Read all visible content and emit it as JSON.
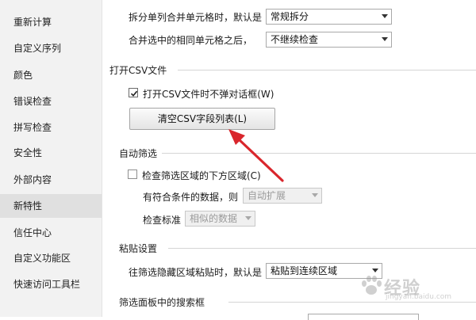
{
  "sidebar": {
    "items": [
      {
        "label": "重新计算"
      },
      {
        "label": "自定义序列"
      },
      {
        "label": "颜色"
      },
      {
        "label": "错误检查"
      },
      {
        "label": "拼写检查"
      },
      {
        "label": "安全性"
      },
      {
        "label": "外部内容"
      },
      {
        "label": "新特性",
        "active": true
      },
      {
        "label": "信任中心"
      },
      {
        "label": "自定义功能区"
      },
      {
        "label": "快速访问工具栏"
      }
    ]
  },
  "merge": {
    "split_label": "拆分单列合并单元格时，默认是",
    "split_value": "常规拆分",
    "after_merge_label": "合并选中的相同单元格之后，",
    "after_merge_value": "不继续检查"
  },
  "csv": {
    "section_title": "打开CSV文件",
    "checkbox_label": "打开CSV文件时不弹对话框(W)",
    "checkbox_checked": true,
    "clear_button": "清空CSV字段列表(L)"
  },
  "autofilter": {
    "section_title": "自动筛选",
    "checkbox_label": "检查筛选区域的下方区域(C)",
    "checkbox_checked": false,
    "condition_label": "有符合条件的数据，则",
    "condition_value": "自动扩展",
    "criteria_label": "检查标准",
    "criteria_value": "相似的数据"
  },
  "paste": {
    "section_title": "粘贴设置",
    "hidden_paste_label": "往筛选隐藏区域粘贴时，默认是",
    "hidden_paste_value": "粘贴到连续区域"
  },
  "filter_panel": {
    "section_title": "筛选面板中的搜索框"
  },
  "watermark": {
    "text": "经验",
    "sub": "jingyan.baidu.com"
  },
  "colors": {
    "annotation_arrow": "#d9262c",
    "sidebar_bg": "#f2f2f2",
    "sidebar_active": "#e0e0e0"
  }
}
